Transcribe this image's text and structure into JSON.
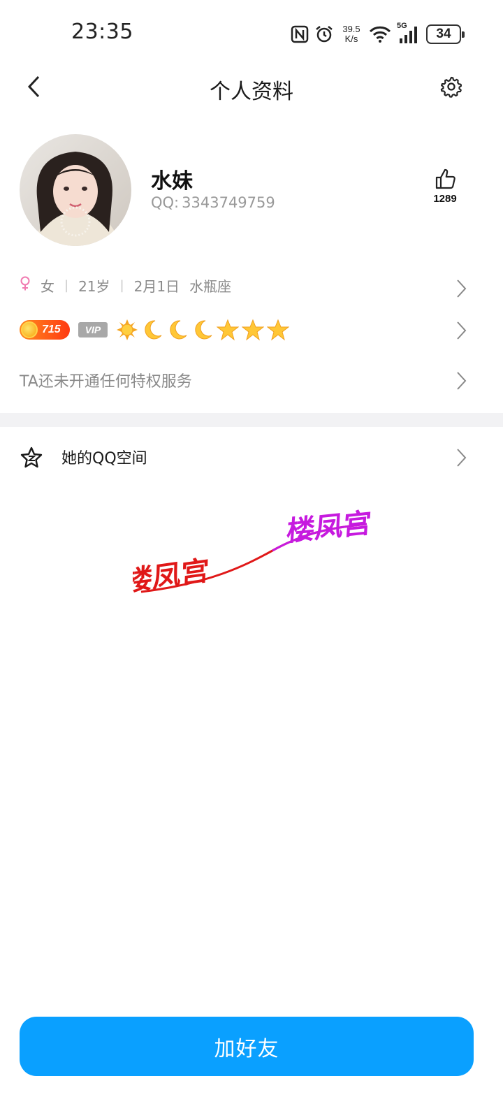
{
  "status_bar": {
    "time": "23:35",
    "net_speed_value": "39.5",
    "net_speed_unit": "K/s",
    "signal_label": "5G",
    "battery": "34",
    "icons": [
      "nfc-icon",
      "alarm-icon",
      "wifi-icon",
      "signal-icon",
      "battery-icon"
    ]
  },
  "nav": {
    "title": "个人资料",
    "back_icon": "chevron-left-icon",
    "settings_icon": "gear-icon"
  },
  "profile": {
    "nickname": "水妹",
    "qq_label": "QQ:",
    "qq_number": "3343749759",
    "like_count": "1289"
  },
  "info": {
    "gender": "女",
    "age": "21岁",
    "birthday": "2月1日",
    "zodiac": "水瓶座"
  },
  "badges": {
    "level": "715",
    "vip": "VIP",
    "level_icons": [
      "sun",
      "moon",
      "moon",
      "moon",
      "star",
      "star",
      "star"
    ],
    "accent_color": "#ff4a14"
  },
  "privilege": {
    "text": "TA还未开通任何特权服务"
  },
  "qzone": {
    "label": "她的QQ空间"
  },
  "watermark": {
    "text_1": "楼凤宫",
    "text_2": "楼凤宫",
    "color_1": "#e01818",
    "color_2": "#c61adf"
  },
  "action": {
    "add_friend": "加好友",
    "button_color": "#0aa0ff"
  }
}
